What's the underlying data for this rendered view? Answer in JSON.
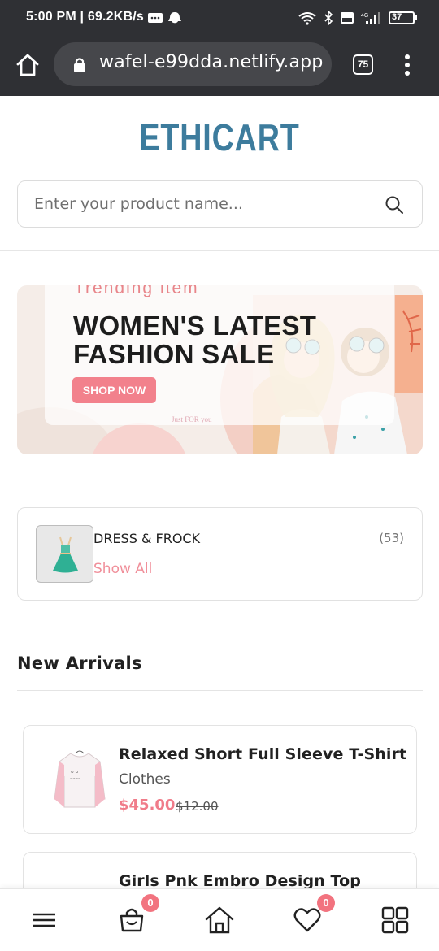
{
  "status_bar": {
    "time": "5:00 PM | 69.2KB/s",
    "battery": "37"
  },
  "browser": {
    "url": "wafel-e99dda.netlify.app",
    "tab_count": "75"
  },
  "header": {
    "logo": "ETHICART"
  },
  "search": {
    "placeholder": "Enter your product name..."
  },
  "banner": {
    "subtitle": "Trending item",
    "title": "WOMEN'S LATEST FASHION SALE",
    "button": "SHOP NOW",
    "decor_text": "Just FOR you"
  },
  "category": {
    "name": "DRESS & FROCK",
    "count": "(53)",
    "link": "Show All"
  },
  "new_arrivals": {
    "heading": "New Arrivals",
    "products": [
      {
        "title": "Relaxed Short Full Sleeve T-Shirt",
        "category": "Clothes",
        "price": "$45.00",
        "old_price": "$12.00"
      },
      {
        "title": "Girls Pnk Embro Design Top",
        "category": "",
        "price": "",
        "old_price": ""
      }
    ]
  },
  "bottom_nav": {
    "cart_count": "0",
    "wishlist_count": "0"
  },
  "colors": {
    "brand": "#3d7c9d",
    "accent": "#f2818c",
    "price": "#f07c8a",
    "chrome": "#2f3034"
  }
}
